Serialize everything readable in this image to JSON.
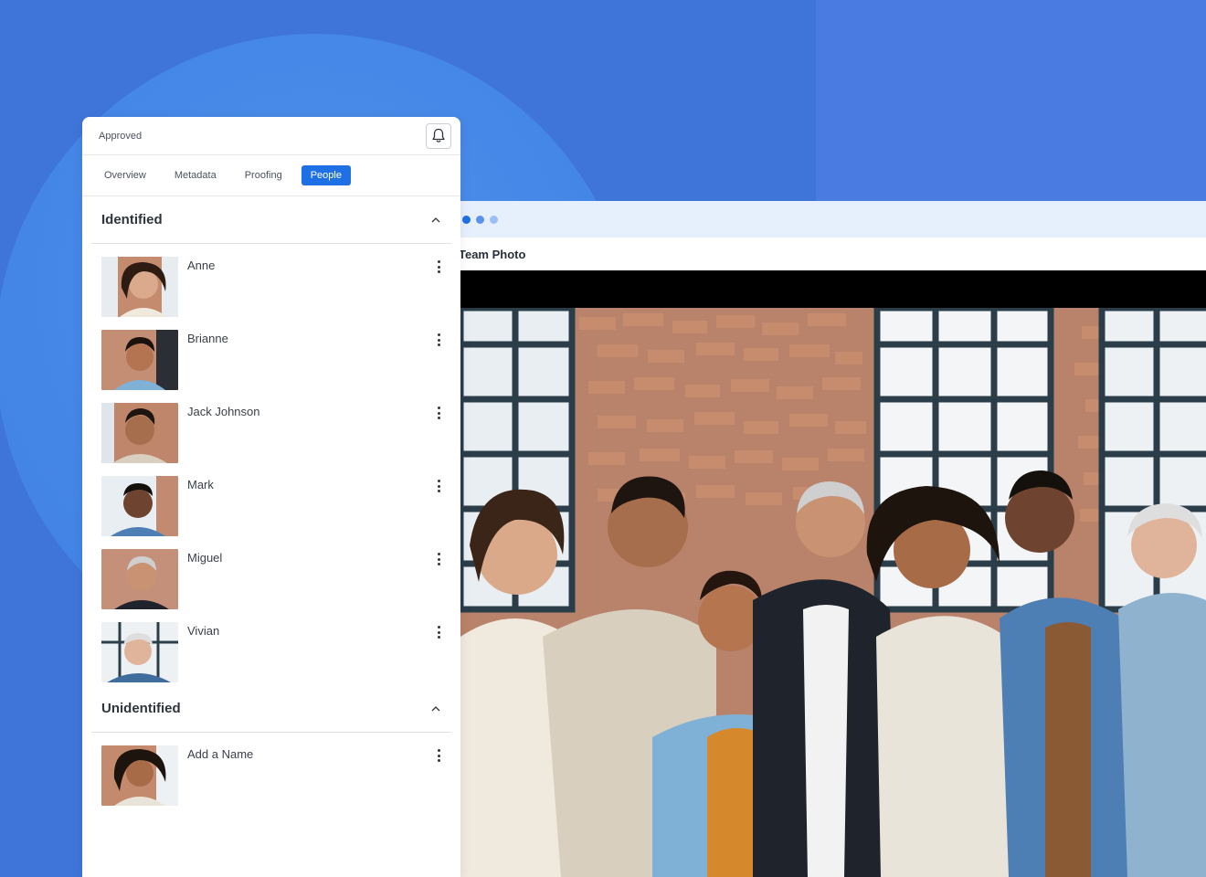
{
  "panel": {
    "status": "Approved",
    "bell_icon": "bell-icon",
    "tabs": [
      {
        "label": "Overview",
        "active": false
      },
      {
        "label": "Metadata",
        "active": false
      },
      {
        "label": "Proofing",
        "active": false
      },
      {
        "label": "People",
        "active": true
      }
    ],
    "sections": {
      "identified": {
        "title": "Identified",
        "people": [
          {
            "name": "Anne"
          },
          {
            "name": "Brianne"
          },
          {
            "name": "Jack Johnson"
          },
          {
            "name": "Mark"
          },
          {
            "name": "Miguel"
          },
          {
            "name": "Vivian"
          }
        ]
      },
      "unidentified": {
        "title": "Unidentified",
        "people": [
          {
            "name": "Add a Name"
          }
        ]
      }
    }
  },
  "photo_window": {
    "title": "Team Photo",
    "dot_colors": [
      "#1f6fe5",
      "#5a92ee",
      "#9dbdf5"
    ]
  },
  "colors": {
    "accent": "#1f6fe5",
    "background": "#3f74d9"
  }
}
